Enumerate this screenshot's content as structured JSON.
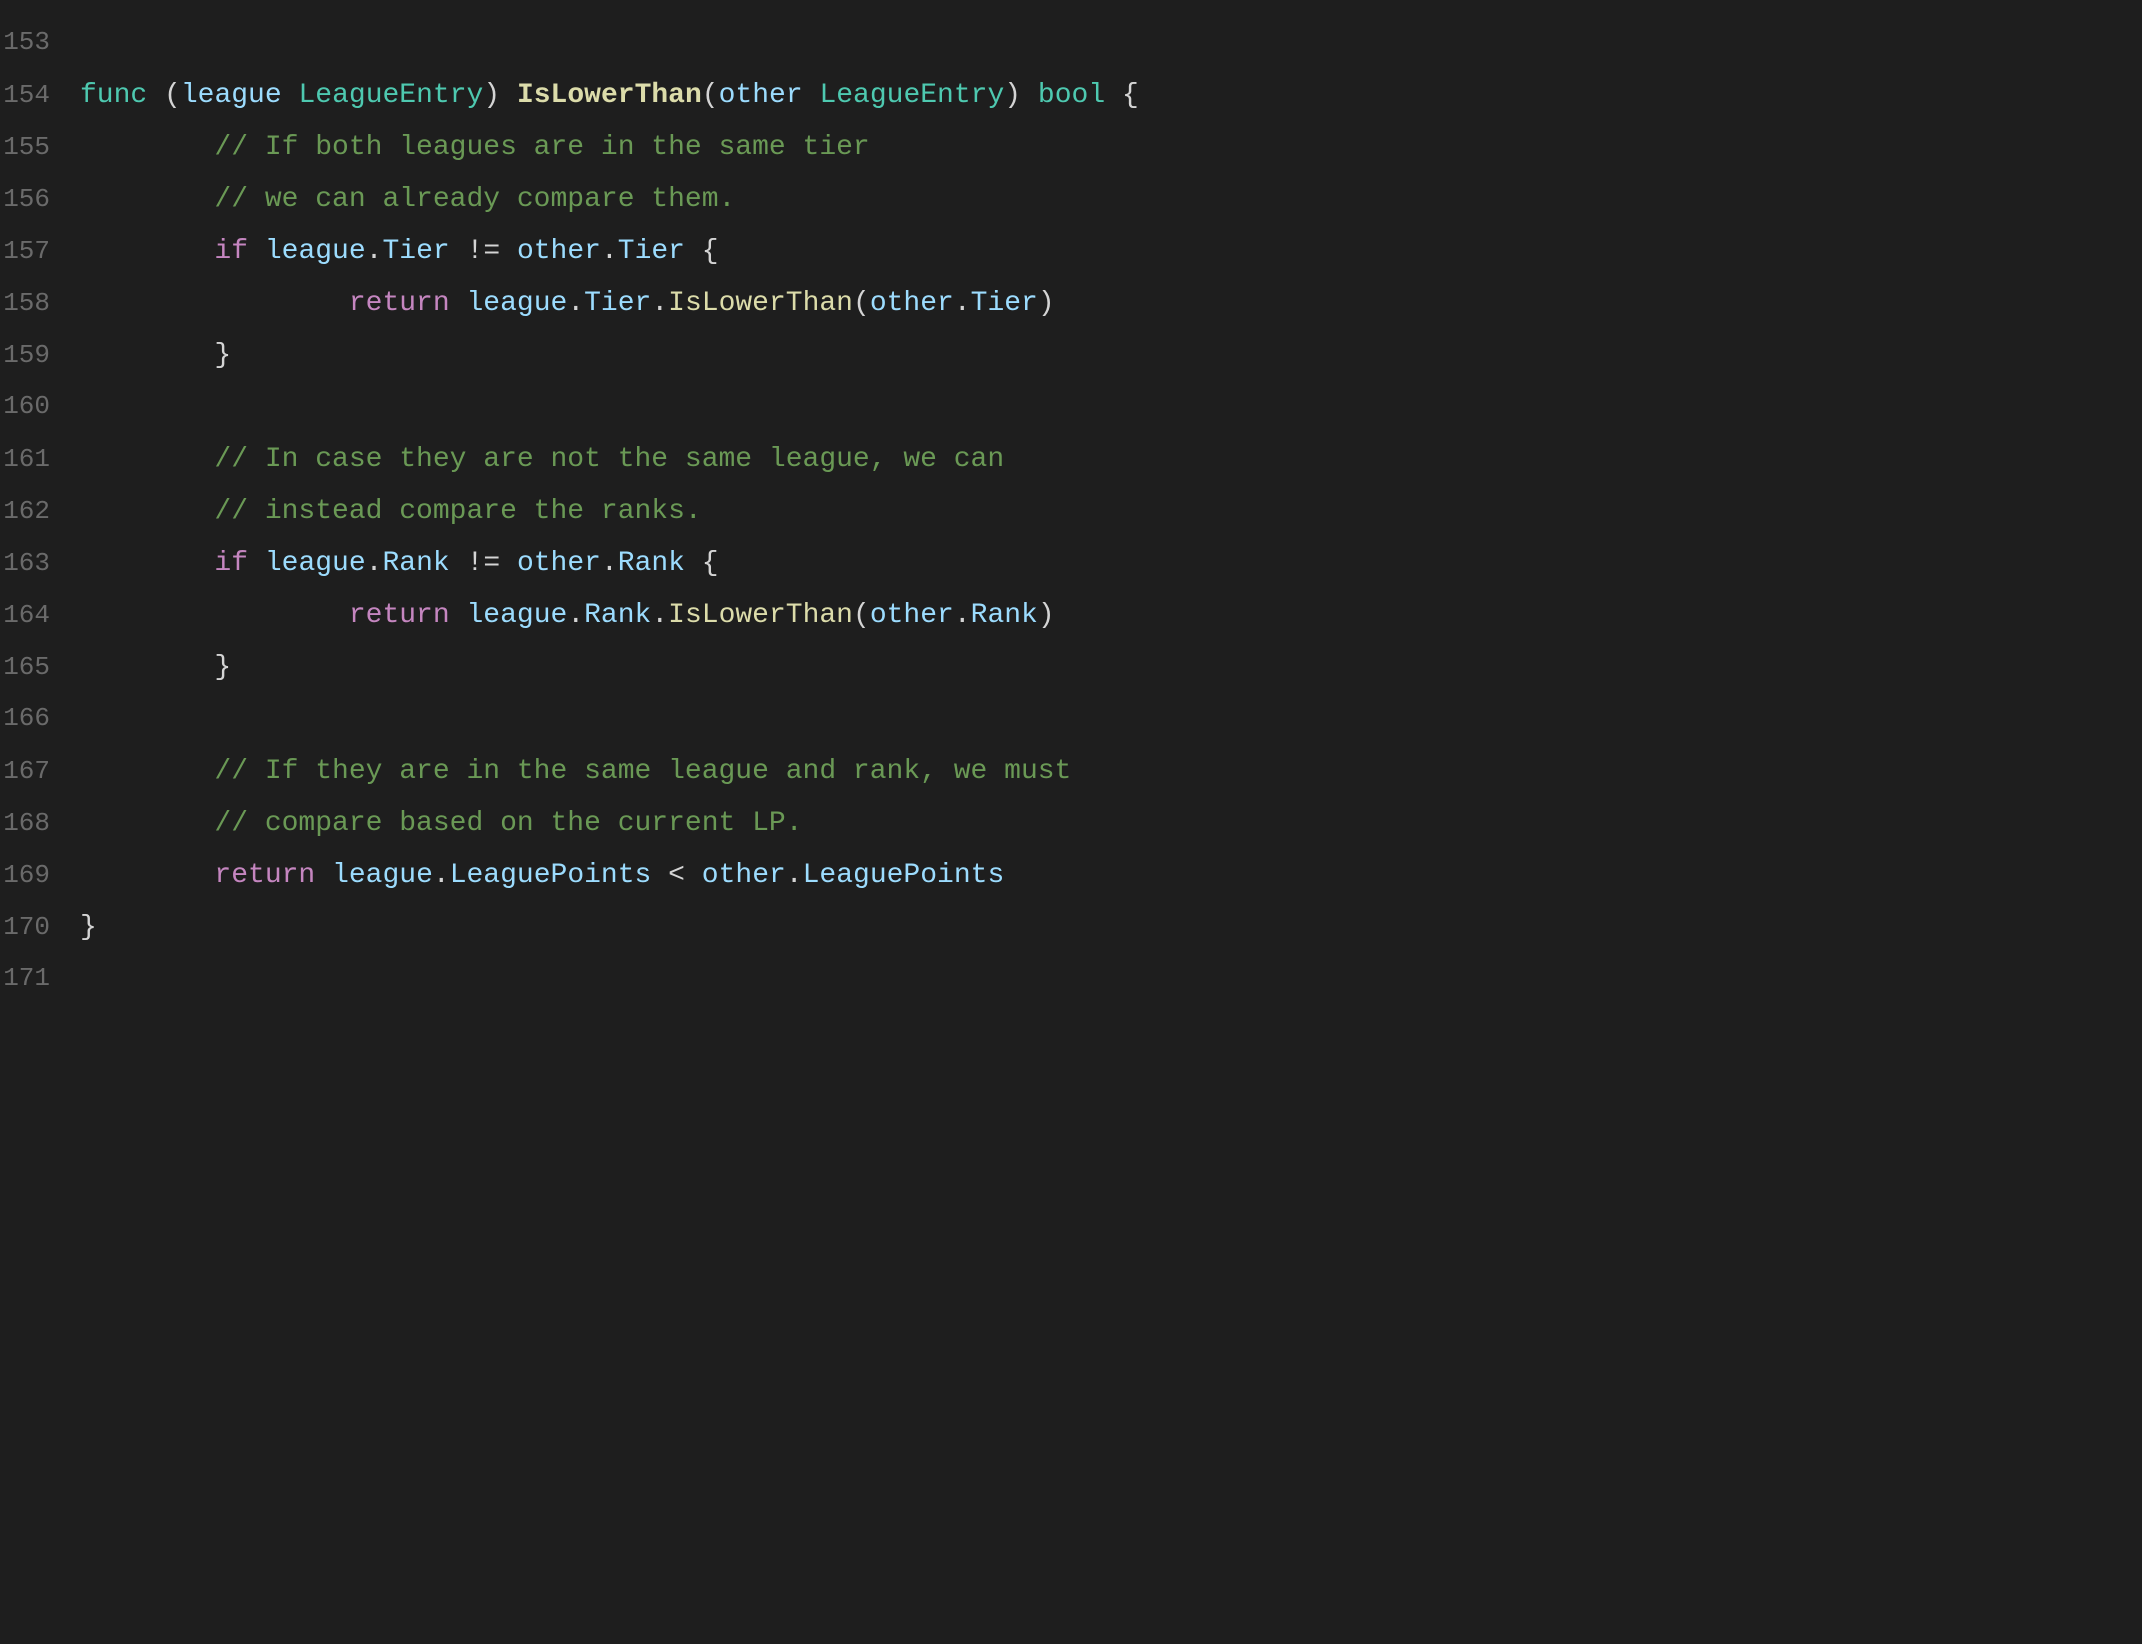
{
  "lines": [
    {
      "num": "153",
      "tokens": []
    },
    {
      "num": "154",
      "content": "func_sig"
    },
    {
      "num": "155",
      "content": "comment1"
    },
    {
      "num": "156",
      "content": "comment2"
    },
    {
      "num": "157",
      "content": "if_tier"
    },
    {
      "num": "158",
      "content": "return_tier"
    },
    {
      "num": "159",
      "content": "close_brace1"
    },
    {
      "num": "160",
      "tokens": []
    },
    {
      "num": "161",
      "content": "comment3"
    },
    {
      "num": "162",
      "content": "comment4"
    },
    {
      "num": "163",
      "content": "if_rank"
    },
    {
      "num": "164",
      "content": "return_rank"
    },
    {
      "num": "165",
      "content": "close_brace2"
    },
    {
      "num": "166",
      "tokens": []
    },
    {
      "num": "167",
      "content": "comment5"
    },
    {
      "num": "168",
      "content": "comment6"
    },
    {
      "num": "169",
      "content": "return_lp"
    },
    {
      "num": "170",
      "content": "close_brace3"
    },
    {
      "num": "171",
      "tokens": []
    }
  ],
  "texts": {
    "line153": "153",
    "line154": "154",
    "line155": "155",
    "line156": "156",
    "line157": "157",
    "line158": "158",
    "line159": "159",
    "line160": "160",
    "line161": "161",
    "line162": "162",
    "line163": "163",
    "line164": "164",
    "line165": "165",
    "line166": "166",
    "line167": "167",
    "line168": "168",
    "line169": "169",
    "line170": "170",
    "line171": "171"
  }
}
